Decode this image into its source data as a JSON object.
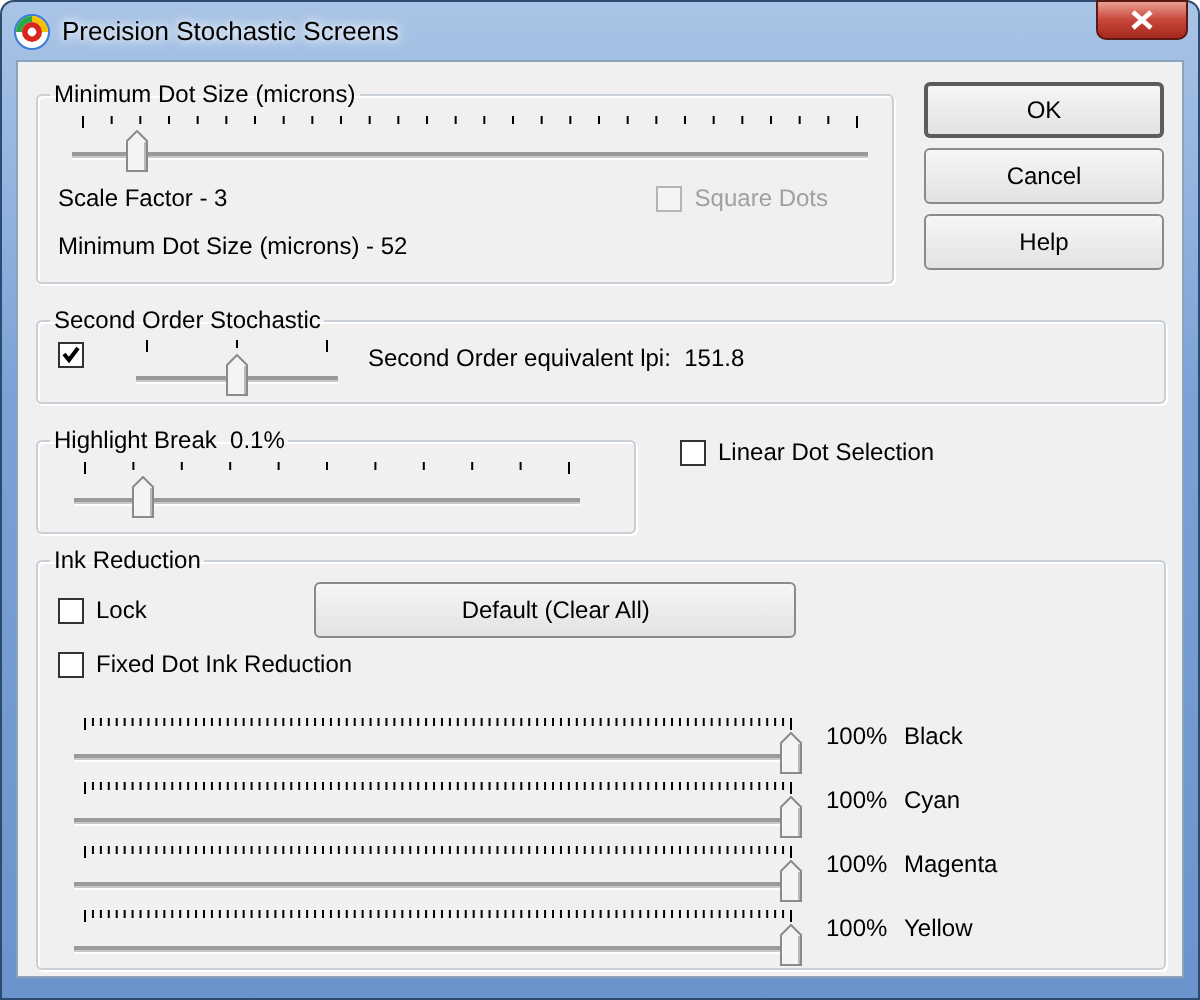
{
  "window": {
    "title": "Precision Stochastic Screens"
  },
  "buttons": [
    {
      "label": "OK",
      "default": true
    },
    {
      "label": "Cancel",
      "default": false
    },
    {
      "label": "Help",
      "default": false
    }
  ],
  "min_dot_size": {
    "title": "Minimum Dot Size (microns)",
    "slider": {
      "level": 0.07
    },
    "scale_factor": "Scale Factor - 3",
    "square_dots": {
      "label": "Square Dots",
      "checked": false,
      "disabled": true
    },
    "readout": "Minimum Dot Size (microns) - 52"
  },
  "second_order": {
    "title": "Second Order Stochastic",
    "checked": true,
    "slider": {
      "level": 0.5
    },
    "readout": "Second Order equivalent lpi:  151.8"
  },
  "highlight_break": {
    "title": "Highlight Break  0.1%",
    "slider": {
      "level": 0.12
    }
  },
  "linear_dot_selection": {
    "label": "Linear Dot Selection",
    "checked": false
  },
  "ink_reduction": {
    "title": "Ink Reduction",
    "lock": {
      "label": "Lock",
      "checked": false
    },
    "default_button": "Default (Clear All)",
    "fixed_dot": {
      "label": "Fixed Dot Ink Reduction",
      "checked": false
    },
    "inks": [
      {
        "level": 1,
        "percent": "100%",
        "name": "Black"
      },
      {
        "level": 1,
        "percent": "100%",
        "name": "Cyan"
      },
      {
        "level": 1,
        "percent": "100%",
        "name": "Magenta"
      },
      {
        "level": 1,
        "percent": "100%",
        "name": "Yellow"
      }
    ]
  }
}
